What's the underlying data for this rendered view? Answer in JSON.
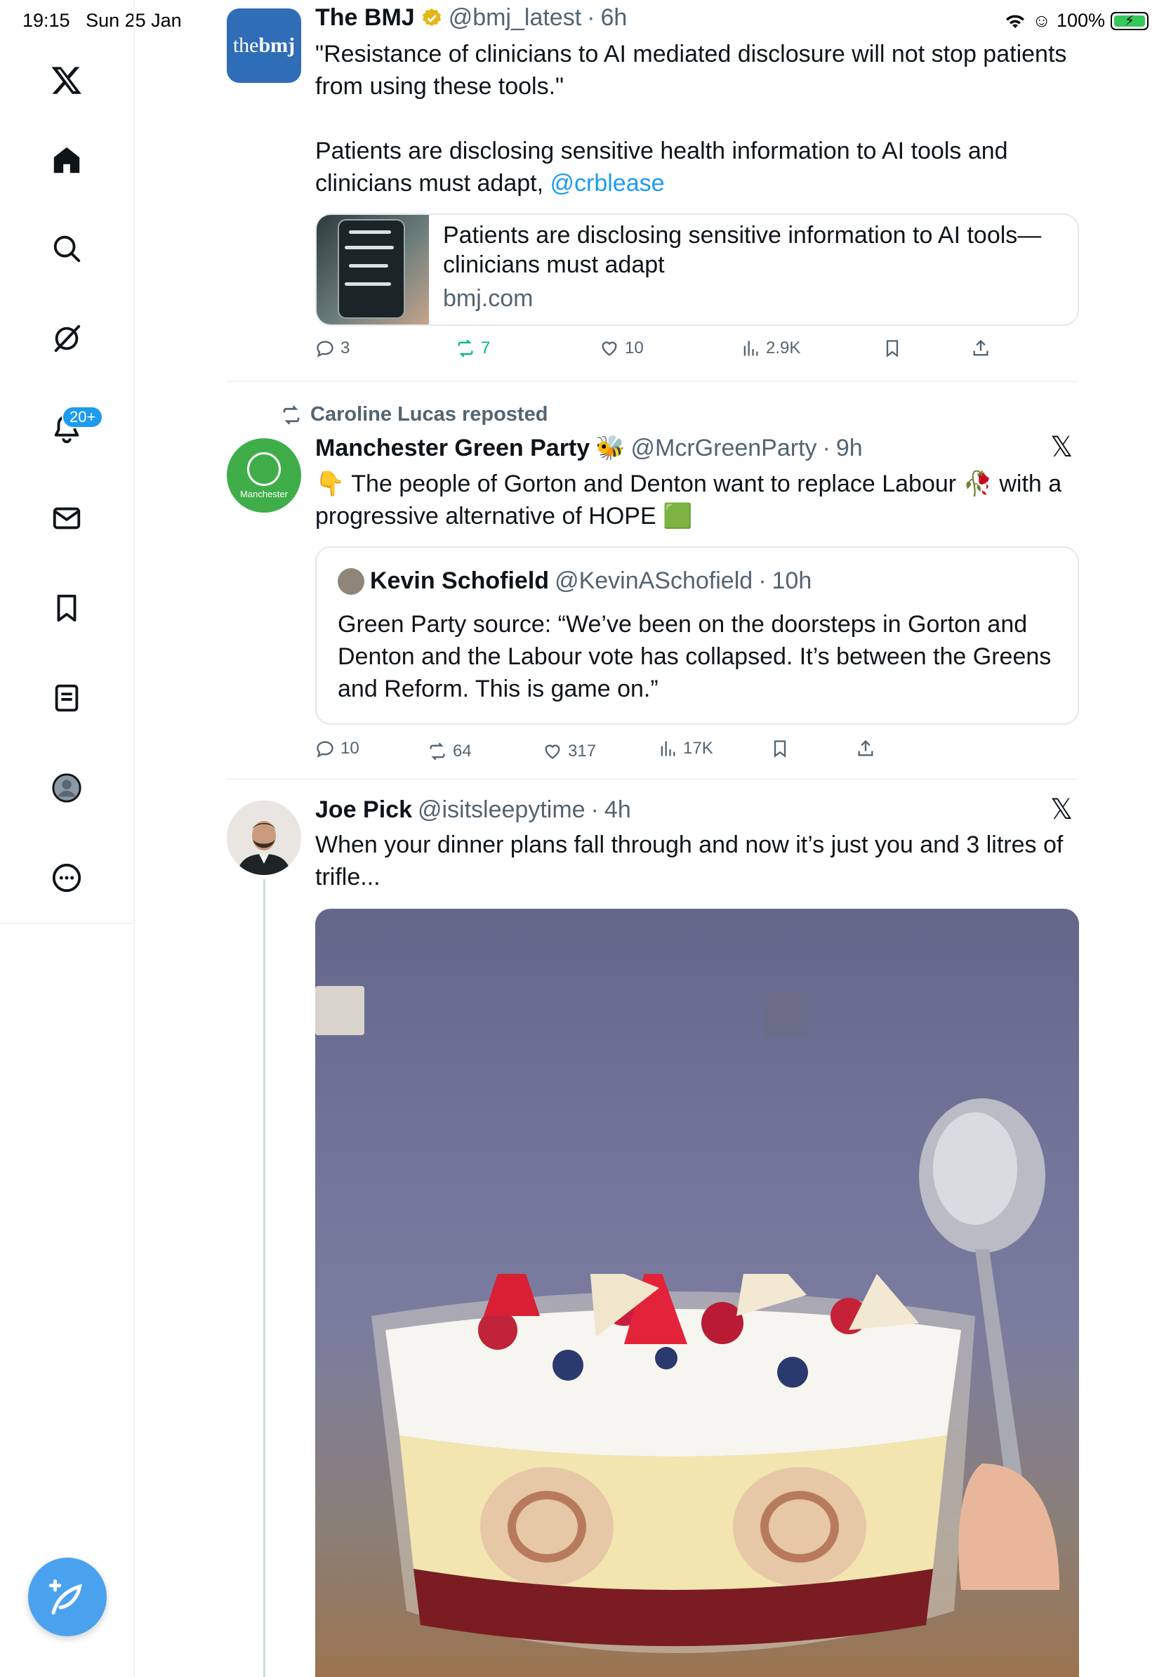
{
  "status_bar": {
    "time": "19:15",
    "date": "Sun 25 Jan",
    "battery": "100%"
  },
  "sidebar": {
    "logo": "x-logo-icon",
    "items": [
      {
        "icon": "home-icon"
      },
      {
        "icon": "search-icon"
      },
      {
        "icon": "grok-icon"
      },
      {
        "icon": "bell-icon",
        "badge": "20+"
      },
      {
        "icon": "mail-icon"
      },
      {
        "icon": "bookmark-icon"
      },
      {
        "icon": "list-icon"
      },
      {
        "icon": "profile-icon"
      },
      {
        "icon": "more-icon"
      }
    ],
    "compose_icon": "compose-icon"
  },
  "tweets": [
    {
      "name": "The BMJ",
      "verified": true,
      "handle": "@bmj_latest",
      "sep": "·",
      "time": "6h",
      "avatar_text_a": "the",
      "avatar_text_b": "bmj",
      "text_1": "\"Resistance of clinicians to AI mediated disclosure will not stop patients from using these tools.\"",
      "text_2": "Patients are disclosing sensitive health information to AI tools and clinicians must adapt,",
      "mention": "@crblease",
      "card": {
        "title": "Patients are disclosing sensitive information to AI tools—clinicians must adapt",
        "domain": "bmj.com"
      },
      "replies": "3",
      "reposts": "7",
      "likes": "10",
      "views": "2.9K"
    },
    {
      "reposted_by": "Caroline Lucas reposted",
      "name": "Manchester Green Party",
      "name_emoji": "🐝",
      "handle": "@McrGreenParty",
      "sep": "·",
      "time": "9h",
      "avatar_text": "Manchester",
      "text_prefix": "👇",
      "text_a": "The people of Gorton and Denton want to replace Labour",
      "text_rose": "🥀",
      "text_b": "with a progressive alternative of HOPE",
      "text_suffix": "🟩",
      "quote": {
        "name": "Kevin Schofield",
        "handle": "@KevinASchofield",
        "sep": "·",
        "time": "10h",
        "text": "Green Party source: “We’ve been on the doorsteps in Gorton and Denton and the Labour vote has collapsed. It’s between the Greens and Reform. This is game on.”"
      },
      "replies": "10",
      "reposts": "64",
      "likes": "317",
      "views": "17K"
    },
    {
      "name": "Joe Pick",
      "handle": "@isitsleepytime",
      "sep": "·",
      "time": "4h",
      "text": "When your dinner plans fall through and now it’s just you and 3 litres of trifle..."
    }
  ],
  "colors": {
    "accent": "#1d9bf0",
    "repost_green": "#00ba7c",
    "muted_text": "#536471"
  }
}
